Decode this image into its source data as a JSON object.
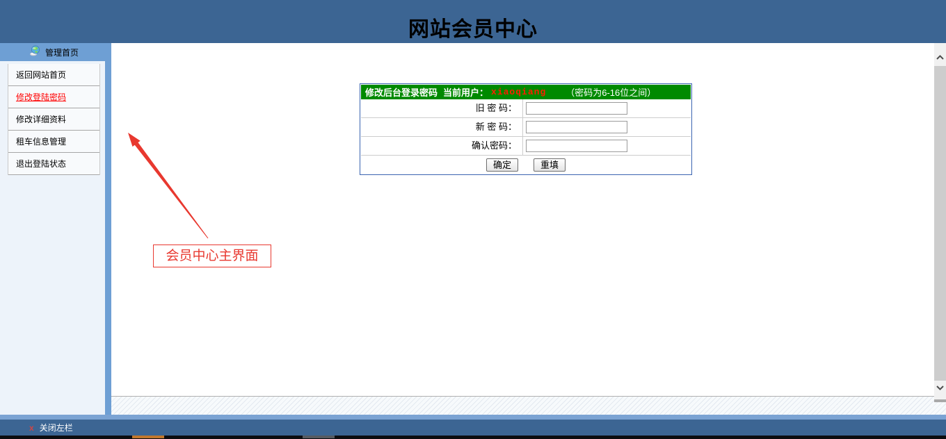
{
  "page": {
    "title": "网站会员中心"
  },
  "sidebar": {
    "header": {
      "label": "管理首页",
      "icon": "globe-monitor-icon"
    },
    "items": [
      {
        "label": "返回网站首页",
        "active": false
      },
      {
        "label": "修改登陆密码",
        "active": true
      },
      {
        "label": "修改详细资料",
        "active": false
      },
      {
        "label": "租车信息管理",
        "active": false
      },
      {
        "label": "退出登陆状态",
        "active": false
      }
    ]
  },
  "form": {
    "header": {
      "title": "修改后台登录密码",
      "current_user_label": "当前用户：",
      "current_user": "xiaoqiang",
      "hint": "（密码为6-16位之间）"
    },
    "fields": [
      {
        "label": "旧 密 码：",
        "value": ""
      },
      {
        "label": "新 密 码：",
        "value": ""
      },
      {
        "label": "确认密码：",
        "value": ""
      }
    ],
    "buttons": {
      "submit": "确定",
      "reset": "重填"
    }
  },
  "annotation": {
    "label": "会员中心主界面",
    "icon": "red-arrow-annotation"
  },
  "footer": {
    "close_icon": "x",
    "close_label": "关闭左栏"
  },
  "scrollbar": {
    "up_icon": "chevron-up-icon",
    "down_icon": "chevron-down-icon"
  },
  "colors": {
    "header_blue": "#3c6593",
    "sidebar_blue": "#6e9fd4",
    "form_border_blue": "#3a64b0",
    "form_header_green": "#008a00",
    "username_red": "#ff1e00",
    "active_item_red": "#ff0000",
    "annotation_red": "#e8382f"
  }
}
